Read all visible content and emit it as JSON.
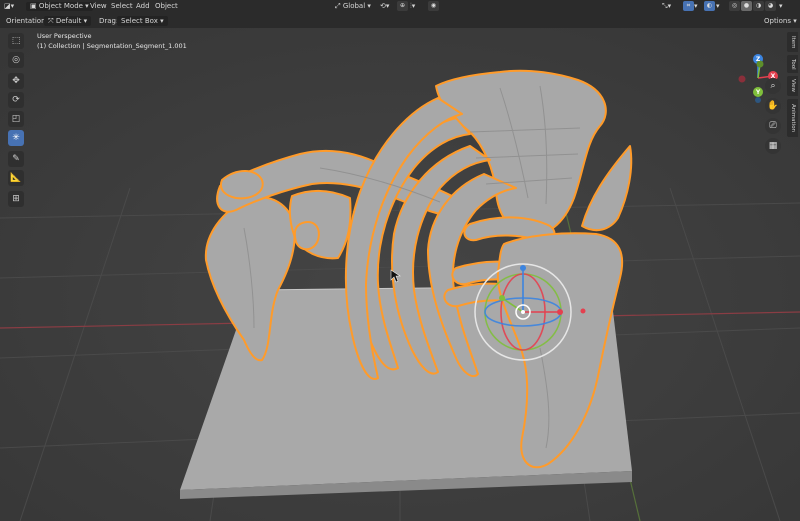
{
  "header": {
    "mode_label": "Object Mode",
    "menus": [
      "View",
      "Select",
      "Add",
      "Object"
    ],
    "transform_orientation": "Global",
    "options_label": "Options"
  },
  "options_bar": {
    "orientation_label": "Orientation:",
    "orientation_value": "Default",
    "drag_label": "Drag:",
    "drag_value": "Select Box"
  },
  "viewport": {
    "view_name": "User Perspective",
    "collection_info": "(1) Collection | Segmentation_Segment_1.001",
    "axis_labels": {
      "x": "X",
      "y": "Y",
      "z": "Z"
    }
  },
  "side_tabs": [
    "Item",
    "Tool",
    "View",
    "Animation"
  ],
  "toolbar_tools": [
    "select-box",
    "cursor",
    "move",
    "rotate",
    "scale",
    "transform",
    "annotate",
    "measure",
    "add-cube"
  ],
  "nav_buttons": [
    "zoom-icon",
    "hand-pan-icon",
    "camera-icon",
    "grid-icon"
  ],
  "colors": {
    "viewport_bg": "#3e3e3e",
    "selection_outline": "#ff9b2a",
    "model": "#a8a8a8",
    "active_tool": "#4772b3",
    "axis_x": "#e4404f",
    "axis_y": "#7fbf3b",
    "axis_z": "#3b84e0"
  }
}
